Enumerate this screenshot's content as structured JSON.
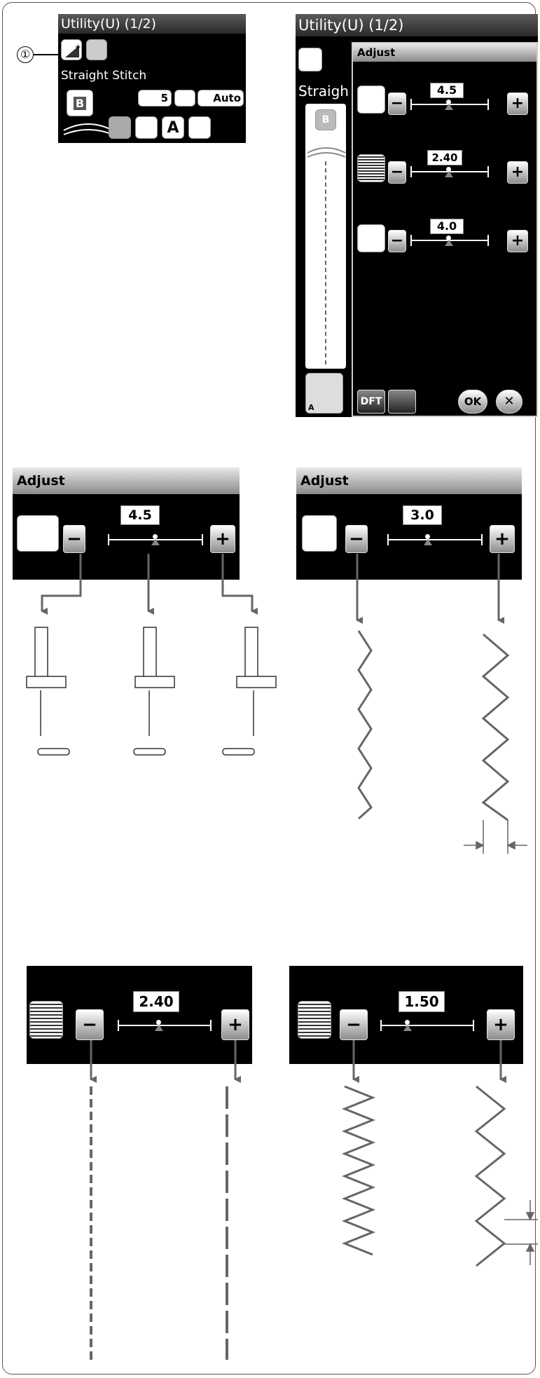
{
  "callout_number": "①",
  "screen1": {
    "title": "Utility(U) (1/2)",
    "stitch_name": "Straight Stitch",
    "pattern_label": "B",
    "foot_setting": "5",
    "tension": "Auto"
  },
  "screen2": {
    "title": "Utility(U) (1/2)",
    "partial_text": "Straigh",
    "pattern_label": "B",
    "foot_label": "A",
    "dialog_title": "Adjust",
    "needle_position": "4.5",
    "stitch_length": "2.40",
    "tension": "4.0",
    "dft_label": "DFT",
    "ok_label": "OK",
    "cancel_label": "✕"
  },
  "panel_needle": {
    "title": "Adjust",
    "value": "4.5"
  },
  "panel_width": {
    "title": "Adjust",
    "value": "3.0"
  },
  "panel_length_straight": {
    "value": "2.40"
  },
  "panel_length_zigzag": {
    "value": "1.50"
  },
  "buttons": {
    "minus": "−",
    "plus": "+"
  }
}
